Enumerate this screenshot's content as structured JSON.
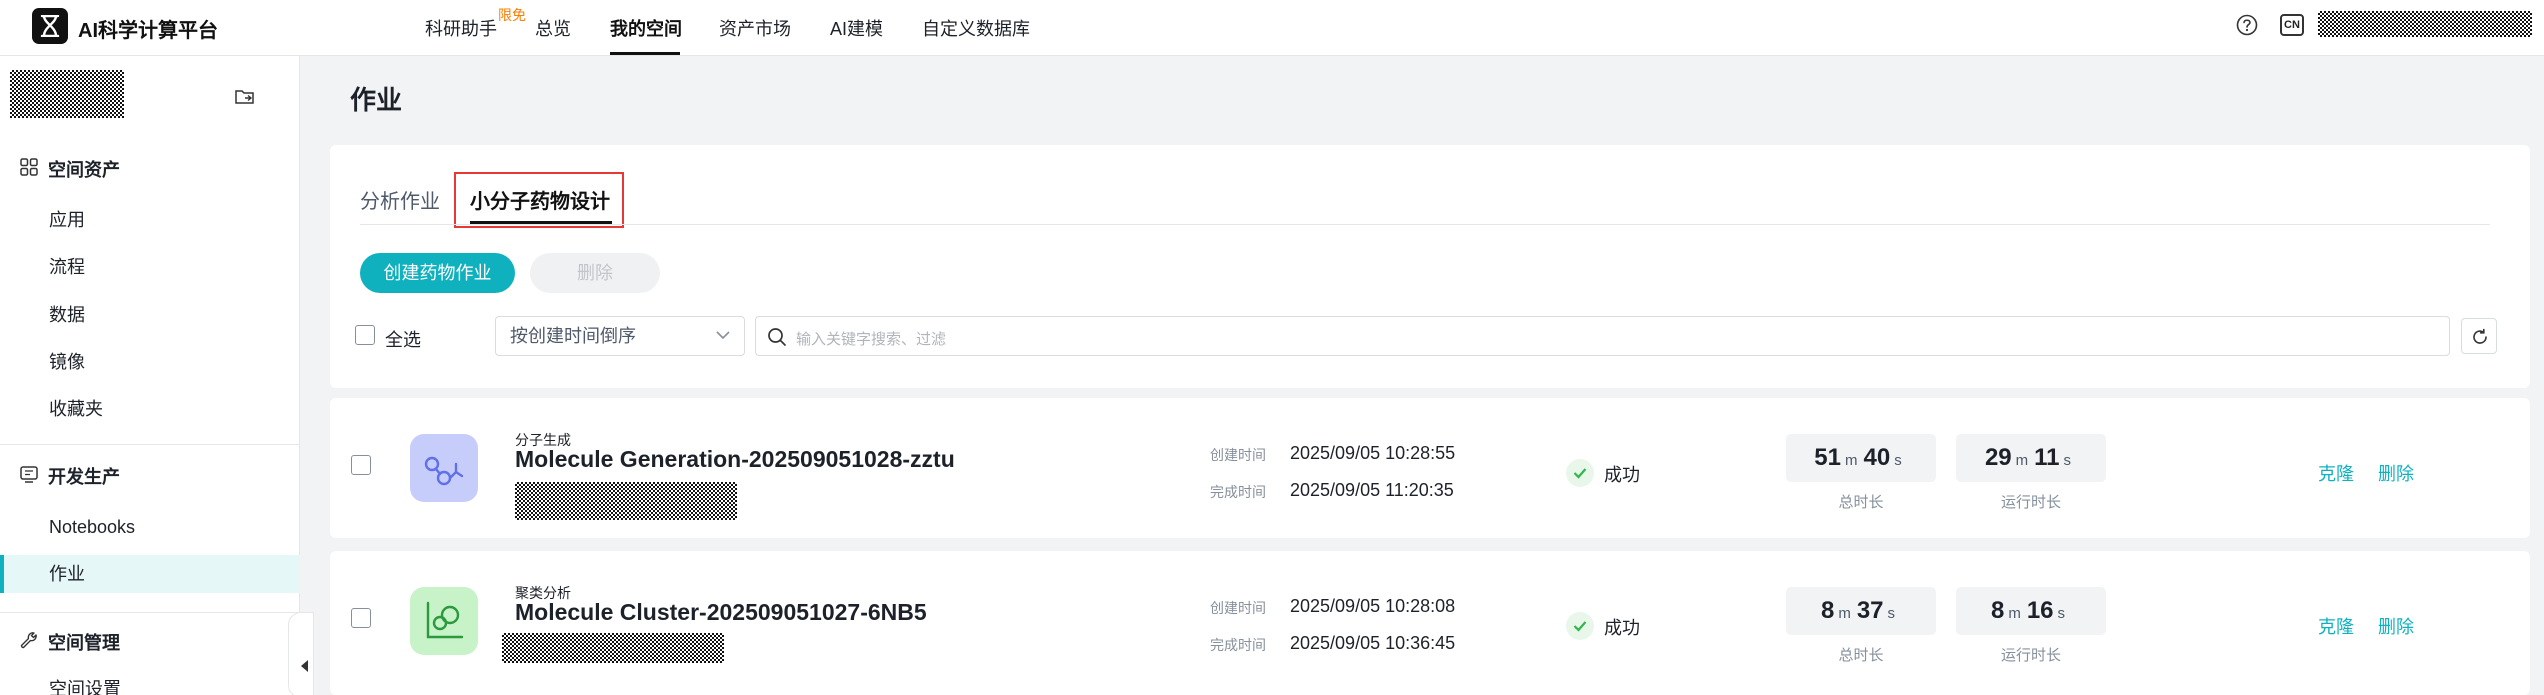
{
  "header": {
    "brand": "AI科学计算平台",
    "nav": [
      {
        "label": "科研助手"
      },
      {
        "label": "总览"
      },
      {
        "label": "我的空间"
      },
      {
        "label": "资产市场"
      },
      {
        "label": "AI建模"
      },
      {
        "label": "自定义数据库"
      }
    ],
    "badge": "限免",
    "lang": "CN",
    "active_nav": "我的空间"
  },
  "sidebar": {
    "groups": [
      {
        "label": "空间资产",
        "icon": "grid-icon",
        "items": [
          "应用",
          "流程",
          "数据",
          "镜像",
          "收藏夹"
        ]
      },
      {
        "label": "开发生产",
        "icon": "monitor-icon",
        "items": [
          "Notebooks",
          "作业"
        ]
      },
      {
        "label": "空间管理",
        "icon": "wrench-icon",
        "items": [
          "空间设置"
        ]
      }
    ],
    "active_item": "作业"
  },
  "page": {
    "title": "作业",
    "tabs": [
      "分析作业",
      "小分子药物设计"
    ],
    "active_tab": "小分子药物设计",
    "create_button": "创建药物作业",
    "delete_button": "删除",
    "select_all": "全选",
    "sort_value": "按创建时间倒序",
    "search_placeholder": "输入关键字搜索、过滤"
  },
  "jobs": [
    {
      "type": "分子生成",
      "name": "Molecule Generation-202509051028-zztu",
      "created_label": "创建时间",
      "created": "2025/09/05 10:28:55",
      "finished_label": "完成时间",
      "finished": "2025/09/05 11:20:35",
      "status": "成功",
      "total": {
        "m": "51",
        "s": "40"
      },
      "run": {
        "m": "29",
        "s": "11"
      },
      "total_label": "总时长",
      "run_label": "运行时长",
      "unit_m": "m",
      "unit_s": "s",
      "actions": [
        "克隆",
        "删除"
      ]
    },
    {
      "type": "聚类分析",
      "name": "Molecule Cluster-202509051027-6NB5",
      "created_label": "创建时间",
      "created": "2025/09/05 10:28:08",
      "finished_label": "完成时间",
      "finished": "2025/09/05 10:36:45",
      "status": "成功",
      "total": {
        "m": "8",
        "s": "37"
      },
      "run": {
        "m": "8",
        "s": "16"
      },
      "total_label": "总时长",
      "run_label": "运行时长",
      "unit_m": "m",
      "unit_s": "s",
      "actions": [
        "克隆",
        "删除"
      ]
    }
  ],
  "colors": {
    "accent": "#0fb1bf",
    "success": "#2fb84a",
    "badge": "#ff7d00",
    "highlight": "#e53935"
  }
}
